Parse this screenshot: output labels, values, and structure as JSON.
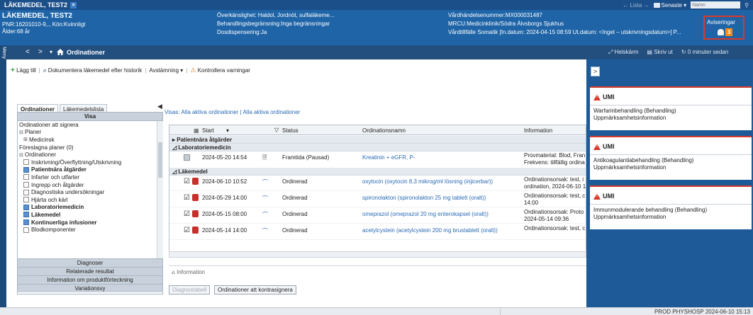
{
  "topbar": {
    "patient_tab": "LÄKEMEDEL, TEST2",
    "close_glyph": "×",
    "lista": "← Lista →",
    "senaste": "Senaste ▾",
    "name_placeholder": "Namn",
    "search_glyph": "⚲"
  },
  "patient": {
    "name": "LÄKEMEDEL, TEST2",
    "pnr": "PNR:16201010-9,., Kön:Kvinnligt",
    "age": "Ålder:68 år",
    "allergy": "Överkänslighet: Haldol, Jordnöt, sulfaläkeme...",
    "treatment_limit": "Behandlingsbegränsning:Inga begränsningar",
    "dose_dispensing": "Dosdispensering:Ja",
    "event_number": "Vårdhändelsenummer:MX000031487",
    "mrcu": "MRCU:Medicinklinik/Södra Älvsborgs Sjukhus",
    "care_episode": "Vårdtillfälle Somatik [In.datum: 2024-04-15 08:59 Ut.datum: <Inget – utskrivningsdatum>] P...",
    "notifications_label": "Aviseringar",
    "notifications_count": "3"
  },
  "nav": {
    "meny": "Meny",
    "back": "<",
    "forward": ">",
    "dropdown": "▾",
    "title": "Ordinationer",
    "fullscreen": "Helskärm",
    "print": "Skriv ut",
    "refresh": "0 minuter sedan"
  },
  "toolbar": {
    "add": "Lägg till",
    "document": "Dokumentera läkemedel efter historik",
    "reconcile": "Avstämning ▾",
    "check_warnings": "Kontrollera varningar"
  },
  "subtabs": [
    "Ordinationer",
    "Läkemedelslista"
  ],
  "left": {
    "collapse": "◀",
    "visa": "Visa",
    "tree": [
      {
        "label": "Ordinationer att signera",
        "type": "plain",
        "indent": 0
      },
      {
        "label": "Planer",
        "type": "minus",
        "indent": 0
      },
      {
        "label": "Medicinsk",
        "type": "plus",
        "indent": 1
      },
      {
        "label": "Föreslagna planer (0)",
        "type": "plain",
        "indent": 0
      },
      {
        "label": "Ordinationer",
        "type": "minus",
        "indent": 0
      },
      {
        "label": "Inskrivning/Överflyttning/Utskrivning",
        "type": "box",
        "indent": 1,
        "checked": false
      },
      {
        "label": "Patientnära åtgärder",
        "type": "box",
        "indent": 1,
        "checked": true
      },
      {
        "label": "Infarter och utfarter",
        "type": "box",
        "indent": 1,
        "checked": false
      },
      {
        "label": "Ingrepp och åtgärder",
        "type": "box",
        "indent": 1,
        "checked": false
      },
      {
        "label": "Diagnostiska undersökningar",
        "type": "box",
        "indent": 1,
        "checked": false
      },
      {
        "label": "Hjärta och kärl",
        "type": "box",
        "indent": 1,
        "checked": false
      },
      {
        "label": "Laboratoriemedicin",
        "type": "box",
        "indent": 1,
        "checked": true
      },
      {
        "label": "Läkemedel",
        "type": "box",
        "indent": 1,
        "checked": true
      },
      {
        "label": "Kontinuerliga infusioner",
        "type": "box",
        "indent": 1,
        "checked": true
      },
      {
        "label": "Blodkomponenter",
        "type": "box",
        "indent": 1,
        "checked": false
      }
    ],
    "sections": [
      "Diagnoser",
      "Relaterade resultat",
      "Information om produktförteckning",
      "Variationsvy"
    ]
  },
  "grid": {
    "visa_line": "Visas: Alla aktiva ordinationer | Alla aktiva ordinationer",
    "headers": {
      "start": "Start",
      "sort": "▾",
      "filter": "▽",
      "status": "Status",
      "name": "Ordinationsnamn",
      "info": "Information"
    },
    "groups": {
      "patient_near": "Patientnära åtgärder",
      "lab": "Laboratoriemedicin",
      "meds": "Läkemedel"
    },
    "lab_row": {
      "start": "2024-05-20 14:54",
      "status": "Framtida (Pausad)",
      "name": "Kreatinin + eGFR, P-",
      "info1": "Provmaterial: Blod, Fran",
      "info2": "Frekvens: tillfällig ordina"
    },
    "med_rows": [
      {
        "start": "2024-06-10 10:52",
        "status": "Ordinerad",
        "name": "oxytocin (oxytocin 8,3 mikrog/ml lösning (injicerbar))",
        "info1": "Ordinationsorsak: test, i",
        "info2": "ordination, 2024-06-10 1"
      },
      {
        "start": "2024-05-29 14:00",
        "status": "Ordinerad",
        "name": "spironolakton (spironolakton 25 mg tablett (oralt))",
        "info1": "Ordinationsorsak: test, c",
        "info2": "14:00"
      },
      {
        "start": "2024-05-15 08:00",
        "status": "Ordinerad",
        "name": "omeprazol (omeprazol 20 mg enterokapsel (oralt))",
        "info1": "Ordinationsorsak: Proto",
        "info2": "2024-05-14 09:36"
      },
      {
        "start": "2024-05-14 14:00",
        "status": "Ordinerad",
        "name": "acetylcystein (acetylcystein 200 mg brustablett (oralt))",
        "info1": "Ordinationsorsak: test, c",
        "info2": ""
      }
    ],
    "info_label": "Information",
    "btn_diag": "Diagnostabell",
    "btn_cosign": "Ordinationer att kontrasignera"
  },
  "alerts": {
    "toggle": ">",
    "cards": [
      {
        "title": "UMI",
        "line1": "Warfarinbehandling (Behandling)",
        "line2": "Uppmärksamhetsinformation"
      },
      {
        "title": "UMI",
        "line1": "Antikoagulantiabehandling (Behandling)",
        "line2": "Uppmärksamhetsinformation"
      },
      {
        "title": "UMI",
        "line1": "Immunmodulerande behandling (Behandling)",
        "line2": "Uppmärksamhetsinformation"
      }
    ]
  },
  "status": {
    "text": "PROD  PHYSHOSP  2024-06-10  15:13"
  },
  "colors": {
    "header_blue": "#1e64a7",
    "alert_red": "#d93a2b",
    "badge_orange": "#f08a1c",
    "link_blue": "#2a6ab4"
  }
}
